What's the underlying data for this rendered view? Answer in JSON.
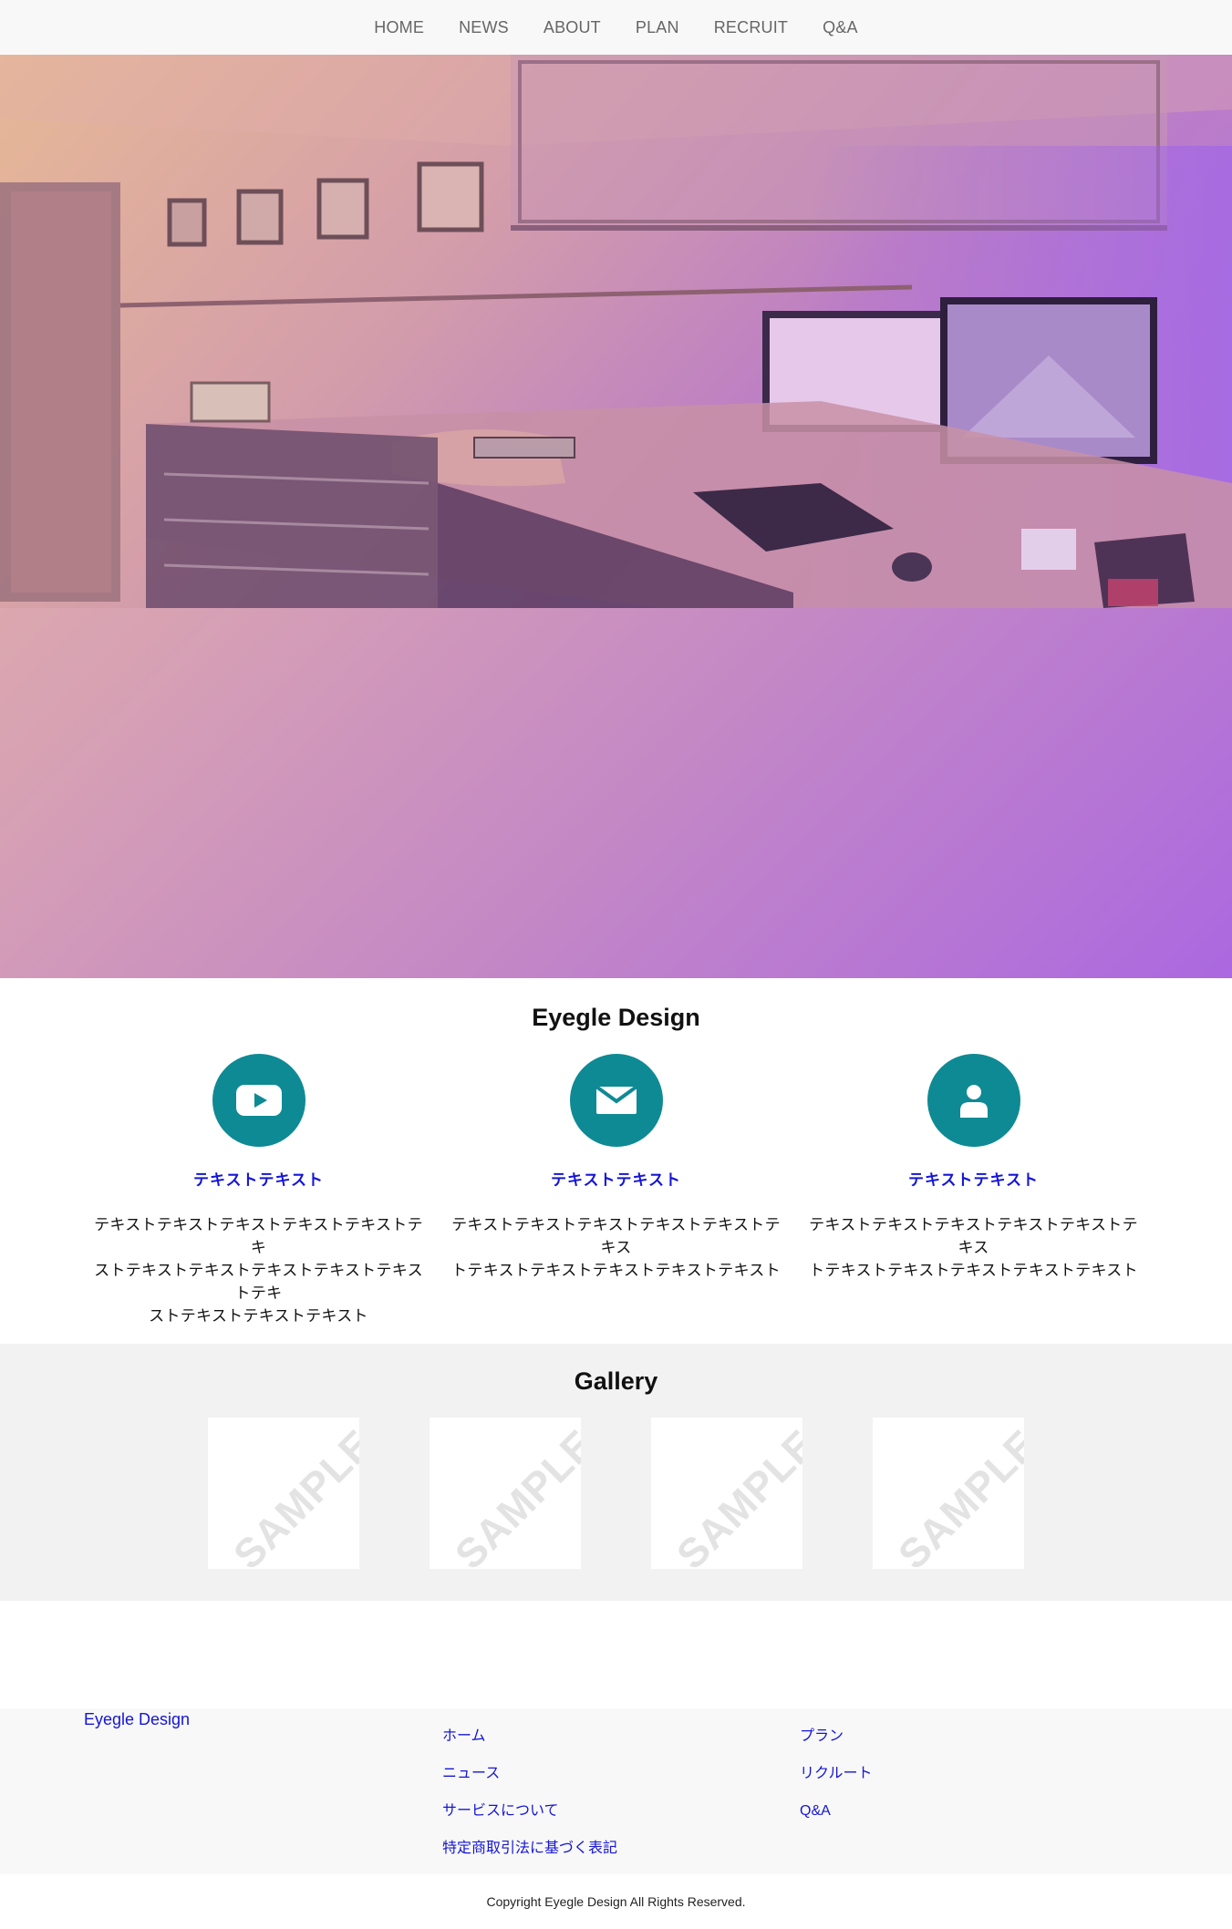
{
  "nav": {
    "items": [
      "HOME",
      "NEWS",
      "ABOUT",
      "PLAN",
      "RECRUIT",
      "Q&A"
    ]
  },
  "features": {
    "title": "Eyegle Design",
    "items": [
      {
        "icon": "youtube-icon",
        "heading": "テキストテキスト",
        "lines": [
          "テキストテキストテキストテキストテキストテキ",
          "ストテキストテキストテキストテキストテキストテキ",
          "ストテキストテキストテキスト"
        ]
      },
      {
        "icon": "mail-icon",
        "heading": "テキストテキスト",
        "lines": [
          "テキストテキストテキストテキストテキストテキス",
          "トテキストテキストテキストテキストテキスト"
        ]
      },
      {
        "icon": "user-icon",
        "heading": "テキストテキスト",
        "lines": [
          "テキストテキストテキストテキストテキストテキス",
          "トテキストテキストテキストテキストテキスト"
        ]
      }
    ]
  },
  "gallery": {
    "title": "Gallery",
    "items": [
      "SAMPLE",
      "SAMPLE",
      "SAMPLE",
      "SAMPLE"
    ]
  },
  "footer": {
    "brand": "Eyegle Design",
    "col1": [
      "ホーム",
      "ニュース",
      "サービスについて",
      "特定商取引法に基づく表記"
    ],
    "col2": [
      "プラン",
      "リクルート",
      "Q&A"
    ],
    "copyright": "Copyright Eyegle Design All Rights Reserved."
  },
  "colors": {
    "accent_teal": "#0e8a94",
    "link_blue": "#1515d6",
    "gradient_start": "#e8b99d",
    "gradient_end": "#ab68e0"
  }
}
